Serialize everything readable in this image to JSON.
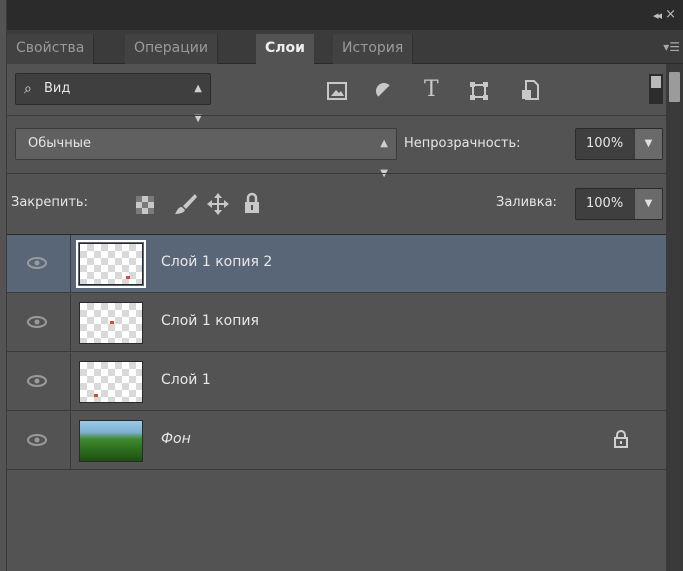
{
  "titlebar": {
    "collapse_glyph": "◂◂",
    "close_glyph": "×"
  },
  "tabs": [
    {
      "label": "Свойства",
      "active": false
    },
    {
      "label": "Операции",
      "active": false
    },
    {
      "label": "Слои",
      "active": true
    },
    {
      "label": "История",
      "active": false
    }
  ],
  "tab_menu_icon": "panel-menu-icon",
  "filter": {
    "search_glyph": "⌕",
    "kind_label": "Вид",
    "icons": [
      "image-filter-icon",
      "adjustment-filter-icon",
      "type-filter-icon",
      "shape-filter-icon",
      "smart-object-filter-icon"
    ],
    "type_glyph": "T"
  },
  "blend": {
    "mode_value": "Обычные",
    "opacity_label": "Непрозрачность:",
    "opacity_value": "100%"
  },
  "lock": {
    "label": "Закрепить:",
    "icons": [
      "lock-transparent-pixels-icon",
      "lock-image-pixels-icon",
      "lock-position-icon",
      "lock-all-icon"
    ],
    "fill_label": "Заливка:",
    "fill_value": "100%"
  },
  "layers": [
    {
      "name": "Слой 1 копия 2",
      "selected": true,
      "visible": true,
      "locked": false
    },
    {
      "name": "Слой 1 копия",
      "selected": false,
      "visible": true,
      "locked": false
    },
    {
      "name": "Слой 1",
      "selected": false,
      "visible": true,
      "locked": false
    },
    {
      "name": "Фон",
      "selected": false,
      "visible": true,
      "locked": true
    }
  ],
  "colors": {
    "panel_bg": "#535353",
    "selected_row": "#596677",
    "tab_bar": "#3b3b3b"
  }
}
